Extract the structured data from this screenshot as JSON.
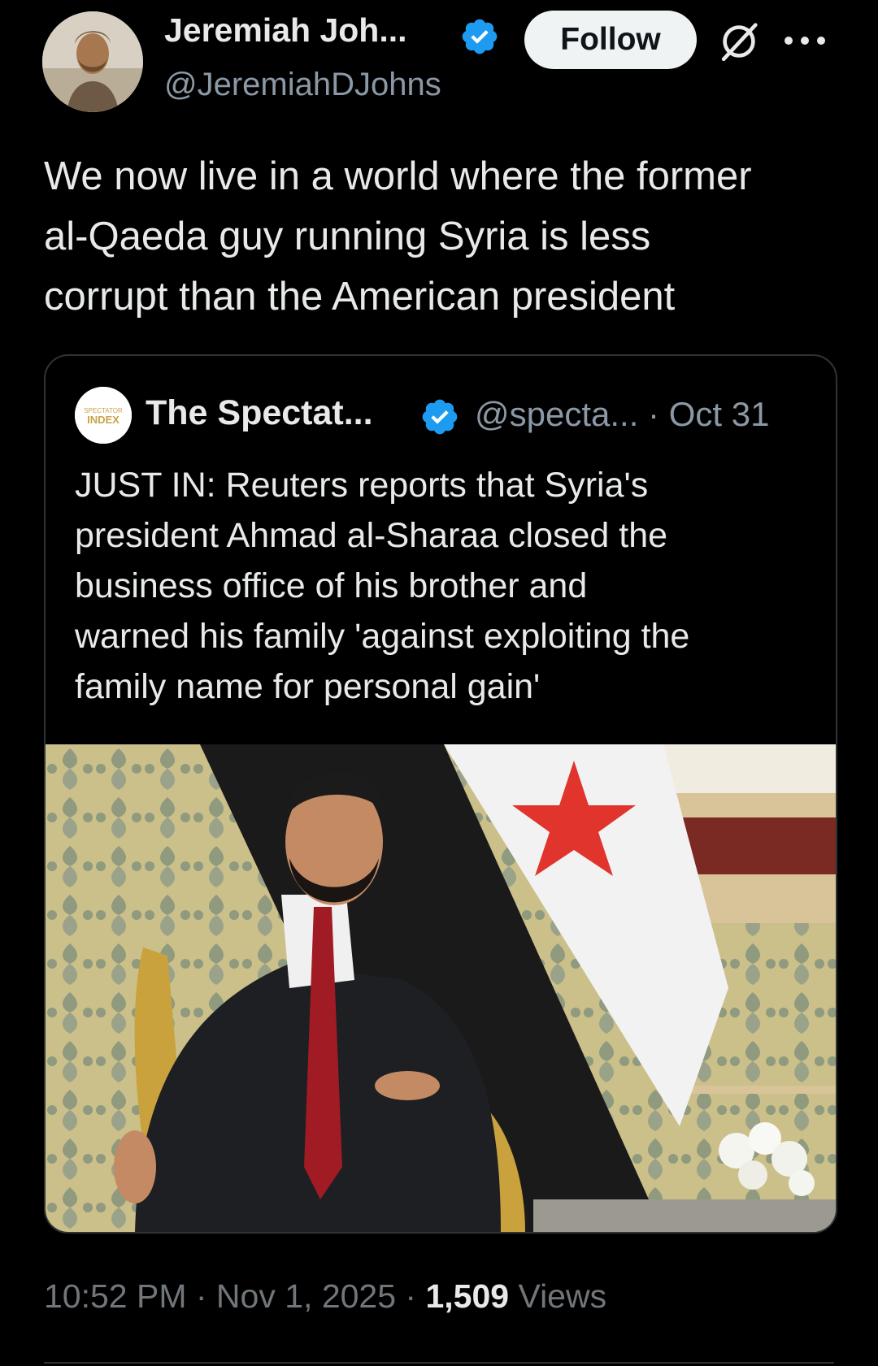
{
  "author": {
    "display_name": "Jeremiah Joh...",
    "handle": "@JeremiahDJohns",
    "verified_icon": "verified-badge-icon",
    "avatar_icon": "user-avatar"
  },
  "actions": {
    "follow_label": "Follow",
    "grok_icon": "grok-icon",
    "more_icon": "more-options-icon"
  },
  "tweet": {
    "text": "We now live in a world where the former\nal-Qaeda guy running Syria is less\ncorrupt than the American president"
  },
  "quoted_tweet": {
    "avatar_text_top": "SPECTATOR",
    "avatar_text_bottom": "INDEX",
    "display_name": "The Spectat...",
    "handle_date": "@specta... · Oct 31",
    "text": "JUST IN: Reuters reports that Syria's\npresident Ahmad al-Sharaa closed the\nbusiness office of his brother and\nwarned his family 'against exploiting the\nfamily name for personal gain'"
  },
  "footer": {
    "time_date": "10:52 PM · Nov 1, 2025 · ",
    "views_count": "1,509",
    "views_label": " Views"
  },
  "colors": {
    "background": "#000000",
    "text": "#e7e9ea",
    "secondary": "#8b98a5",
    "verified": "#1d9bf0",
    "border": "#2f3336"
  }
}
